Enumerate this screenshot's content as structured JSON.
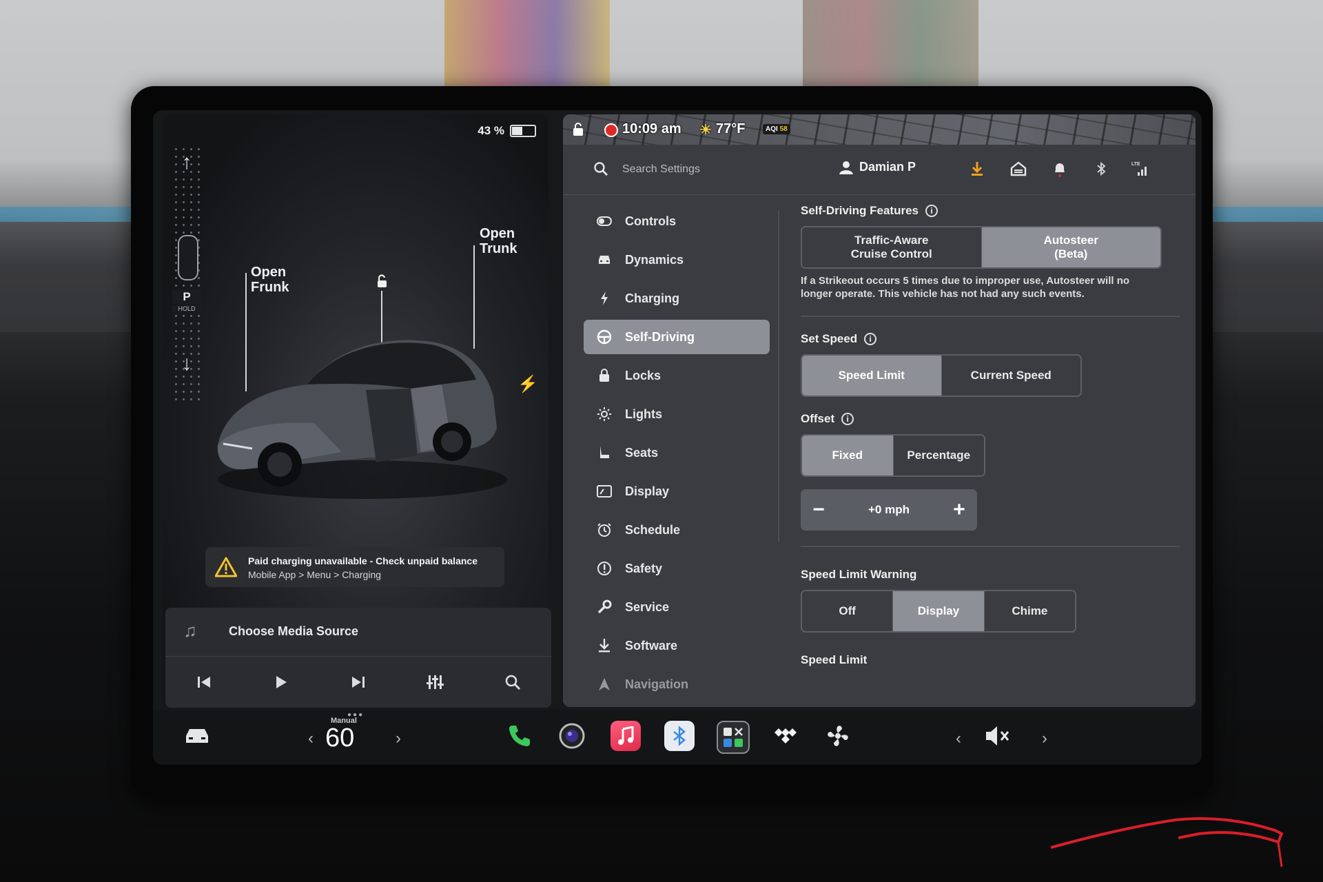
{
  "status": {
    "battery_percent": "43 %",
    "time": "10:09 am",
    "temperature": "77°F",
    "aqi_label": "AQI",
    "aqi_value": "58"
  },
  "vehicle": {
    "gear": "P",
    "gear_sub": "HOLD",
    "frunk_label_1": "Open",
    "frunk_label_2": "Frunk",
    "trunk_label_1": "Open",
    "trunk_label_2": "Trunk"
  },
  "alert": {
    "title": "Paid charging unavailable - Check unpaid balance",
    "subtitle": "Mobile App > Menu > Charging"
  },
  "media": {
    "source_label": "Choose Media Source"
  },
  "header": {
    "search_placeholder": "Search Settings",
    "user_name": "Damian P"
  },
  "nav": {
    "items": [
      {
        "label": "Controls"
      },
      {
        "label": "Dynamics"
      },
      {
        "label": "Charging"
      },
      {
        "label": "Self-Driving"
      },
      {
        "label": "Locks"
      },
      {
        "label": "Lights"
      },
      {
        "label": "Seats"
      },
      {
        "label": "Display"
      },
      {
        "label": "Schedule"
      },
      {
        "label": "Safety"
      },
      {
        "label": "Service"
      },
      {
        "label": "Software"
      },
      {
        "label": "Navigation"
      }
    ],
    "active": "Self-Driving"
  },
  "self_driving": {
    "features_title": "Self-Driving Features",
    "feature_options": [
      "Traffic-Aware\nCruise Control",
      "Autosteer\n(Beta)"
    ],
    "feature_selected": "Autosteer (Beta)",
    "strikeout_note": "If a Strikeout occurs 5 times due to improper use, Autosteer will no longer operate. This vehicle has not had any such events.",
    "set_speed_title": "Set Speed",
    "set_speed_options": [
      "Speed Limit",
      "Current Speed"
    ],
    "set_speed_selected": "Speed Limit",
    "offset_title": "Offset",
    "offset_options": [
      "Fixed",
      "Percentage"
    ],
    "offset_selected": "Fixed",
    "offset_value": "+0 mph",
    "warning_title": "Speed Limit Warning",
    "warning_options": [
      "Off",
      "Display",
      "Chime"
    ],
    "warning_selected": "Display",
    "speed_limit_title": "Speed Limit"
  },
  "taskbar": {
    "speed_mode": "Manual",
    "speed": "60"
  },
  "colors": {
    "accent_selected": "#8d9096",
    "panel_bg": "#3a3c41",
    "warning_yellow": "#f2c230",
    "download_orange": "#f0a020",
    "rec_red": "#e02a2a"
  }
}
